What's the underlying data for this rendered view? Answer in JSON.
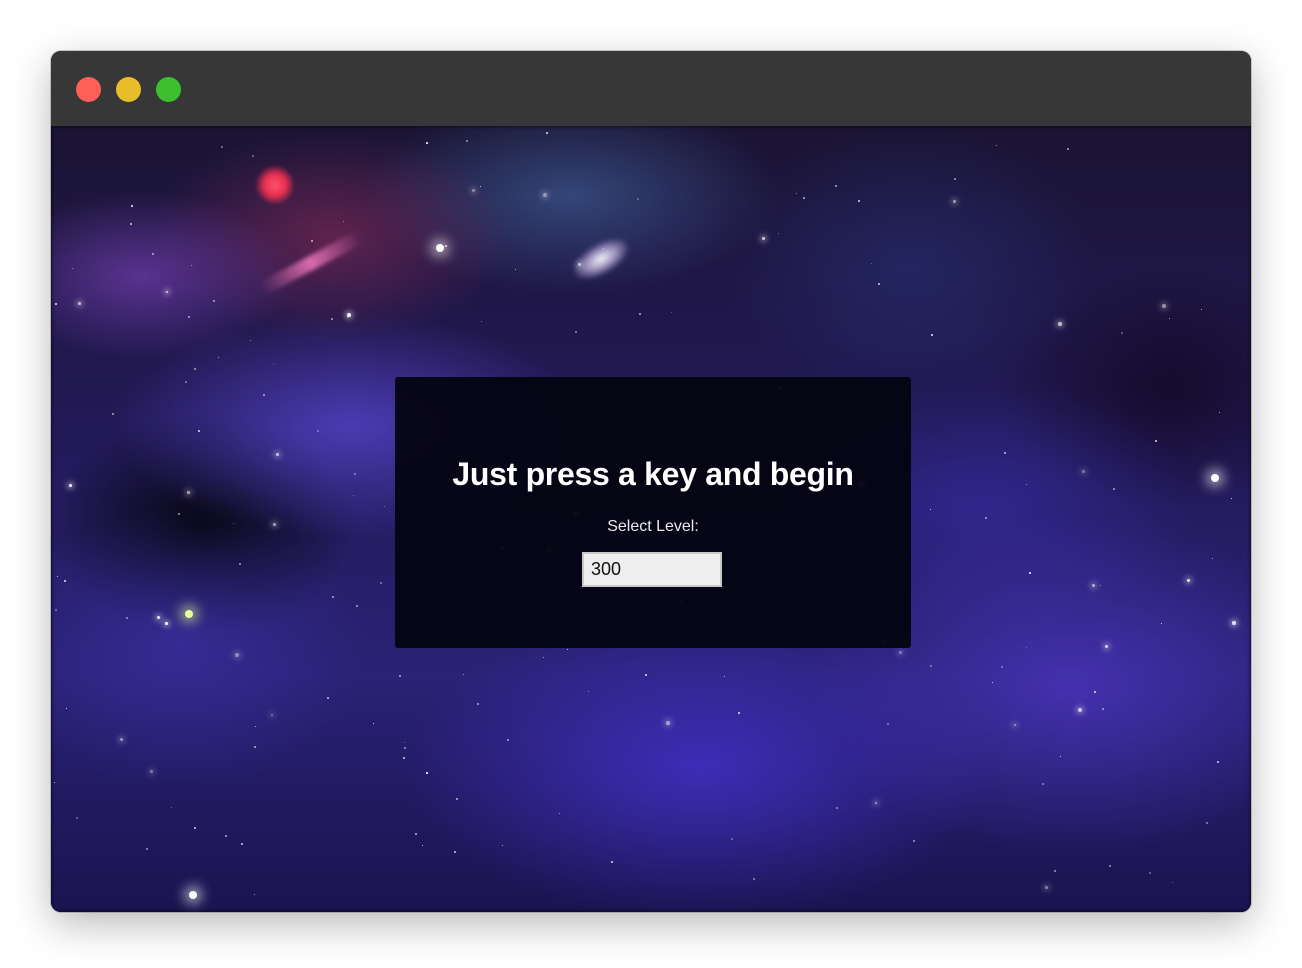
{
  "window": {
    "controls": [
      {
        "name": "close",
        "color": "#fe5f57"
      },
      {
        "name": "minimize",
        "color": "#e9bd29"
      },
      {
        "name": "zoom",
        "color": "#3cc02f"
      }
    ]
  },
  "game": {
    "title": "Just press a key and begin",
    "level_label": "Select Level:",
    "level_value": "300"
  },
  "colors": {
    "panel_background": "#03030e",
    "title_text": "#ffffff",
    "titlebar": "#373737"
  }
}
